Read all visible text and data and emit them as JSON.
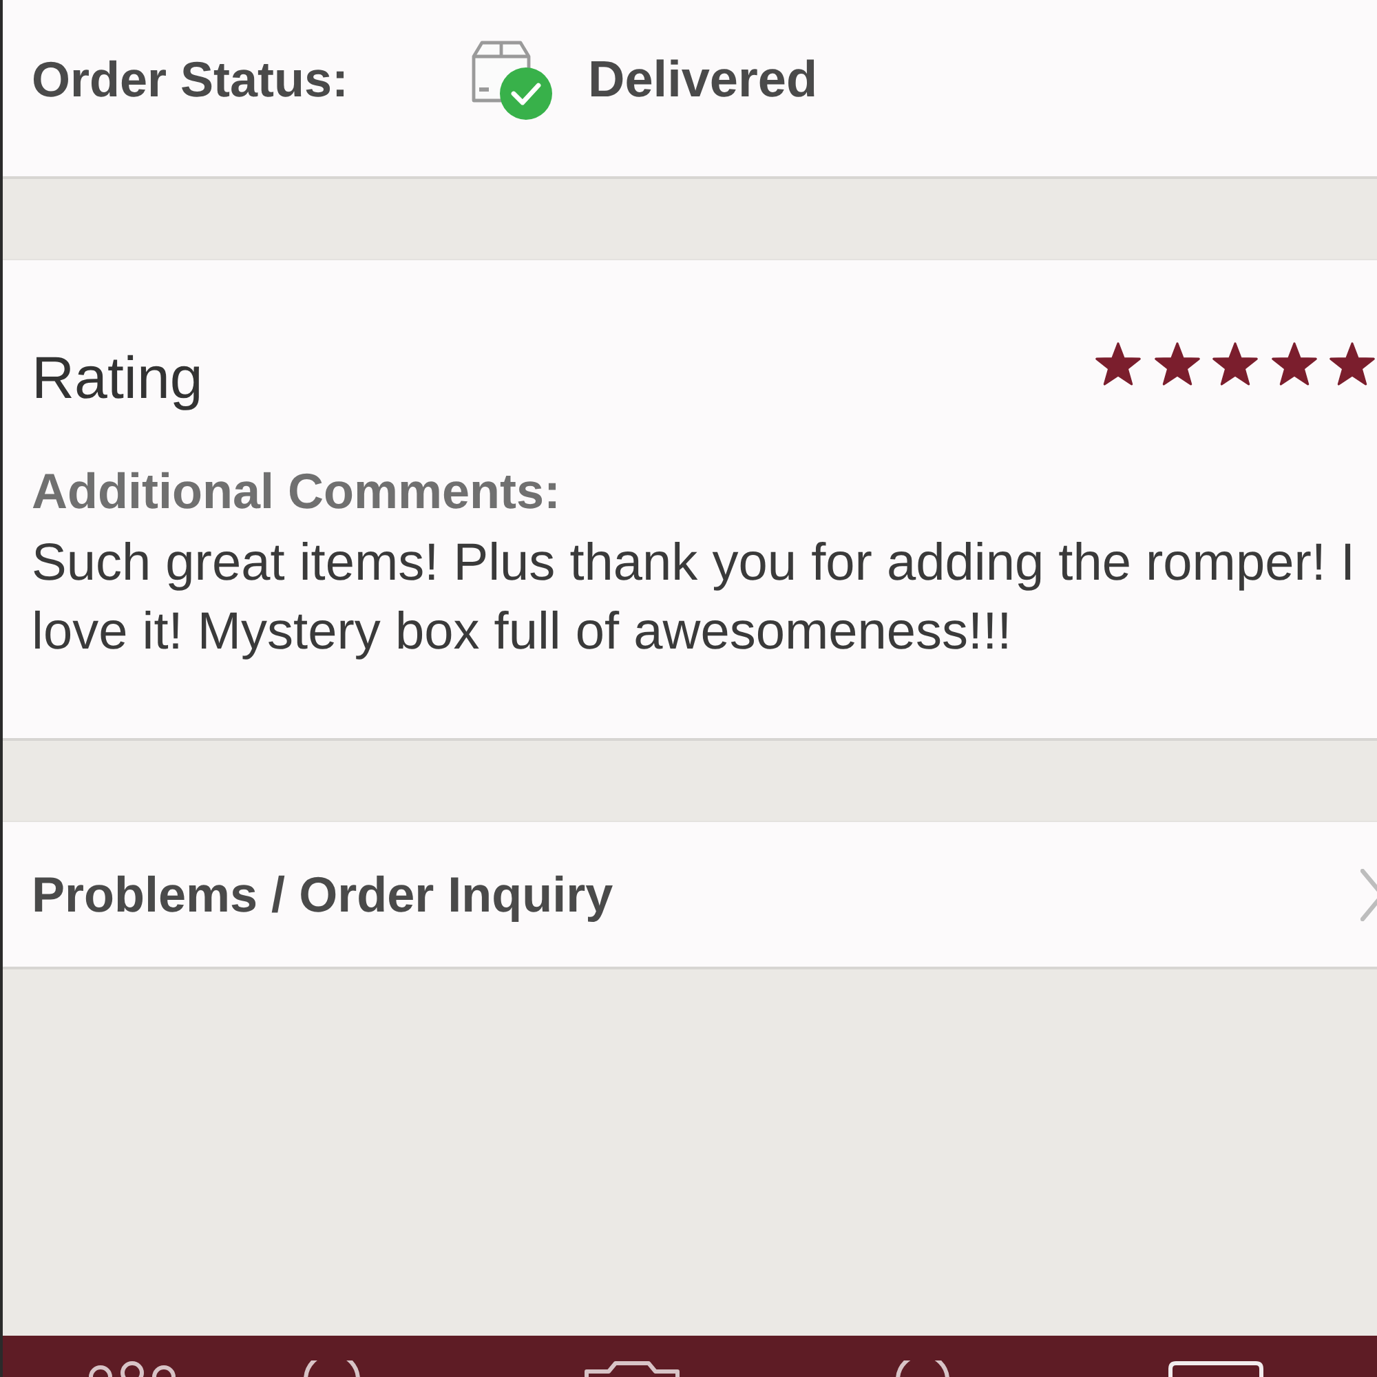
{
  "order_status": {
    "label": "Order Status:",
    "value": "Delivered"
  },
  "rating": {
    "title": "Rating",
    "stars": 5,
    "comments_label": "Additional Comments:",
    "comment": "Such great items! Plus thank you for adding the romper! I love it! Mystery box full of awesomeness!!!"
  },
  "inquiry": {
    "label": "Problems / Order Inquiry"
  }
}
